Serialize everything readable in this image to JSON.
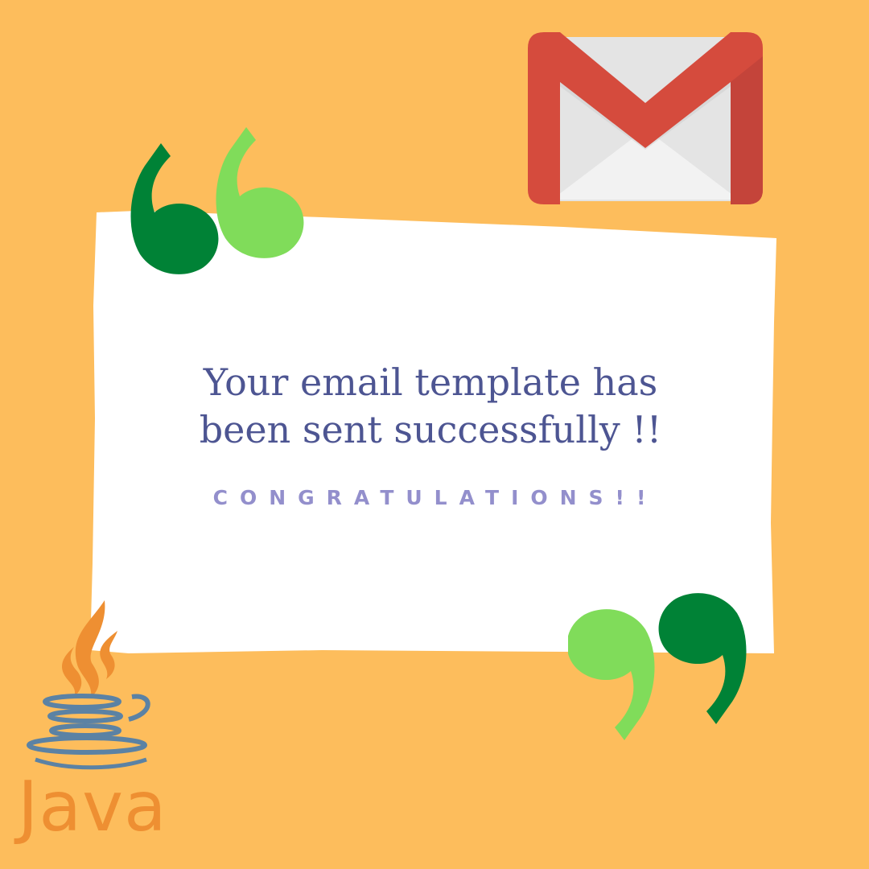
{
  "message": {
    "line1": "Your email template has",
    "line2": "been sent successfully !!"
  },
  "subtitle": "CONGRATULATIONS!!",
  "java": {
    "wordmark": "Java"
  },
  "icons": {
    "mail": "gmail-logo-icon",
    "open_quote": "open-quote-icon",
    "close_quote": "close-quote-icon",
    "java_cup": "java-cup-icon"
  },
  "colors": {
    "background": "#fdbd5c",
    "card": "#ffffff",
    "message_text": "#4d5592",
    "subtitle_text": "#938fcc",
    "quote_dark": "#008236",
    "quote_light": "#80dc5a",
    "gmail_red": "#d54b3d",
    "java_orange": "#ee8f32",
    "java_blue": "#5b82a4"
  }
}
